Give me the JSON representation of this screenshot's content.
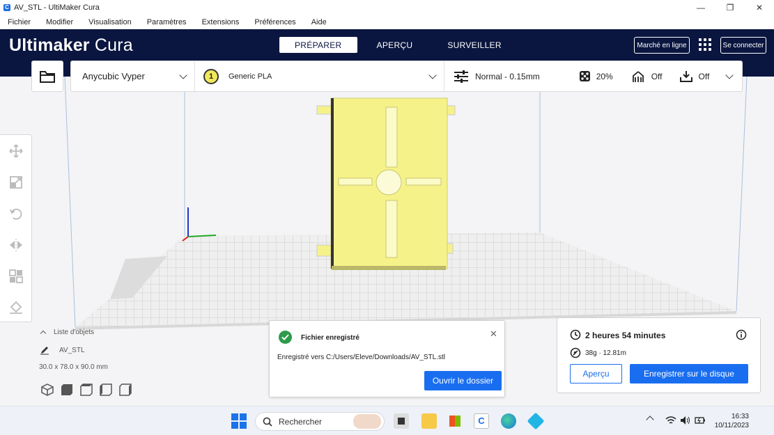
{
  "window": {
    "title": "AV_STL - UltiMaker Cura",
    "minimize": "—",
    "maximize": "❐",
    "close": "✕"
  },
  "menu": [
    "Fichier",
    "Modifier",
    "Visualisation",
    "Paramètres",
    "Extensions",
    "Préférences",
    "Aide"
  ],
  "header": {
    "logo_bold": "Ultimaker",
    "logo_light": " Cura",
    "tabs": [
      {
        "label": "PRÉPARER",
        "active": true
      },
      {
        "label": "APERÇU",
        "active": false
      },
      {
        "label": "SURVEILLER",
        "active": false
      }
    ],
    "marketplace": "Marché en ligne",
    "signin": "Se connecter"
  },
  "toolbar": {
    "printer": "Anycubic Vyper",
    "material_index": "1",
    "material": "Generic PLA",
    "profile": "Normal - 0.15mm",
    "infill": "20%",
    "support": "Off",
    "adhesion": "Off"
  },
  "object_list": {
    "label": "Liste d'objets",
    "object_name": "AV_STL",
    "dimensions": "30.0 x 78.0 x 90.0 mm"
  },
  "notification": {
    "title": "Fichier enregistré",
    "message": "Enregistré vers C:/Users/Eleve/Downloads/AV_STL.stl",
    "button": "Ouvrir le dossier",
    "close": "✕"
  },
  "print_info": {
    "time": "2 heures 54 minutes",
    "material": "38g · 12.81m",
    "preview_button": "Aperçu",
    "save_button": "Enregistrer sur le disque"
  },
  "taskbar": {
    "search_placeholder": "Rechercher",
    "time": "16:33",
    "date": "10/11/2023"
  },
  "colors": {
    "header_bg": "#0a1640",
    "accent": "#196ef0",
    "model": "#f5f28a",
    "success": "#2c9b4b"
  }
}
